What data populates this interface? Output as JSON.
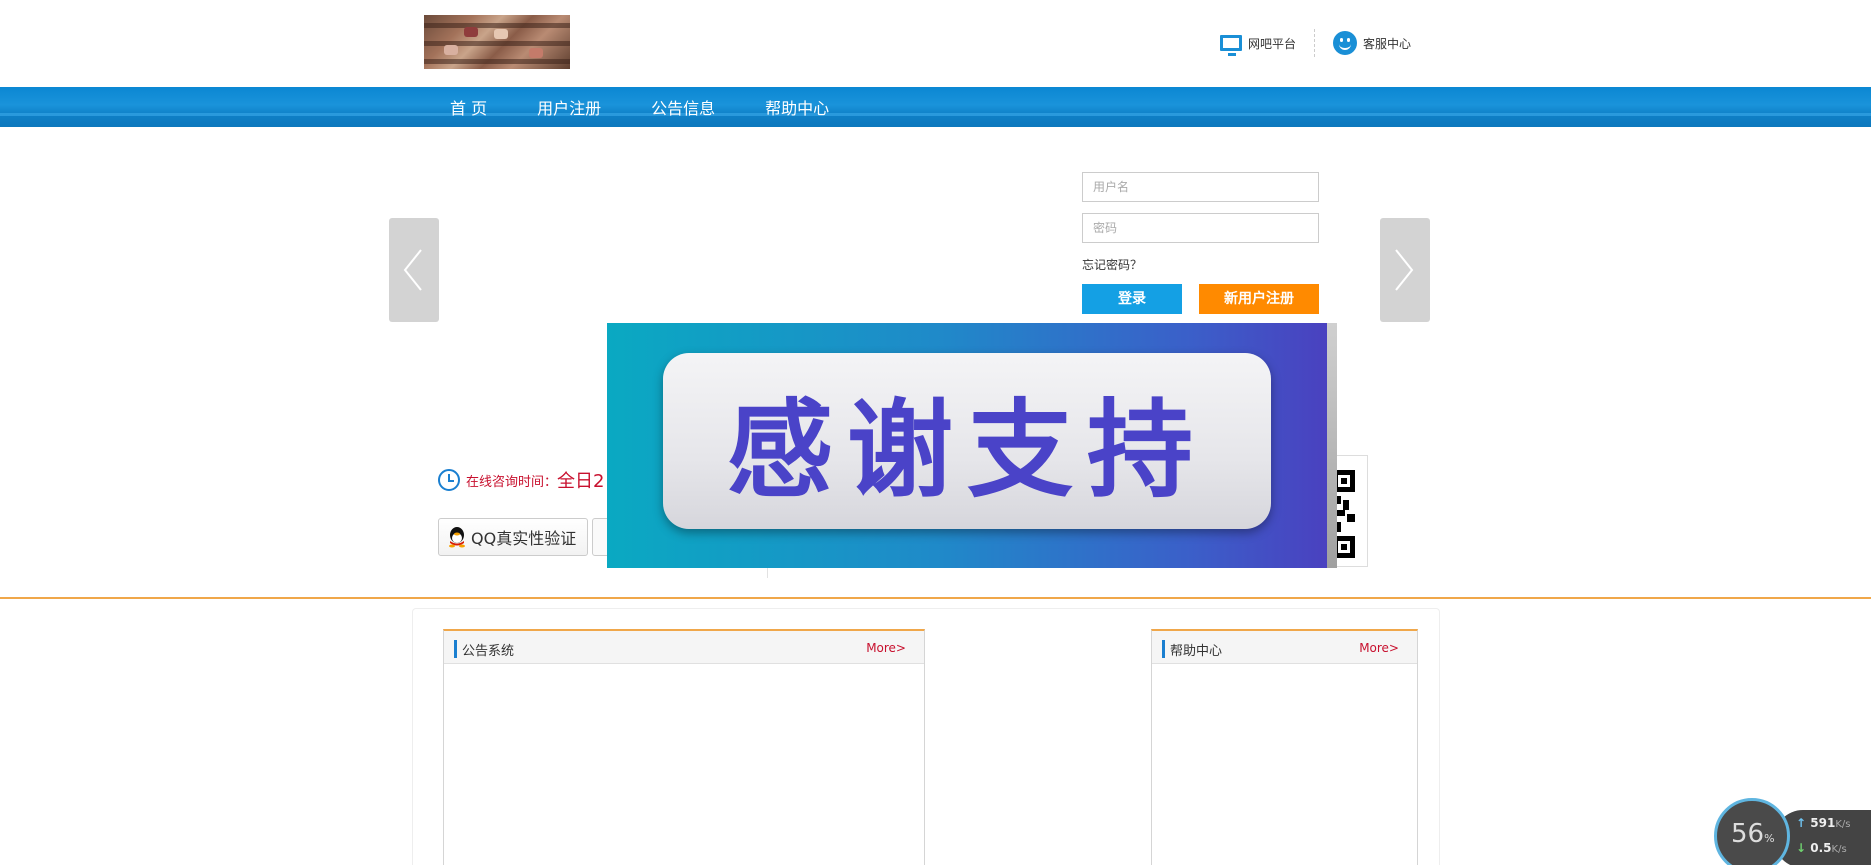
{
  "header": {
    "logo_alt": "logo",
    "links": [
      {
        "label": "网吧平台",
        "icon": "monitor-icon"
      },
      {
        "label": "客服中心",
        "icon": "smiley-icon"
      }
    ]
  },
  "nav": {
    "items": [
      "首 页",
      "用户注册",
      "公告信息",
      "帮助中心"
    ]
  },
  "login": {
    "username_placeholder": "用户名",
    "password_placeholder": "密码",
    "forgot_label": "忘记密码？",
    "login_label": "登录",
    "register_label": "新用户注册"
  },
  "consult": {
    "label": "在线咨询时间：",
    "value": "全日2"
  },
  "qq_button_label": "QQ真实性验证",
  "overlay": {
    "text": "感谢支持"
  },
  "panels": {
    "notice": {
      "title": "公告系统",
      "more": "More>"
    },
    "help": {
      "title": "帮助中心",
      "more": "More>"
    }
  },
  "speed_widget": {
    "percent": "56",
    "percent_unit": "%",
    "upload": "591",
    "upload_unit": "K/s",
    "download": "0.5",
    "download_unit": "K/s"
  },
  "colors": {
    "nav_blue": "#0b87d3",
    "accent_orange": "#ff8a00",
    "login_blue": "#14a0e4",
    "divider_orange": "#f0a74a",
    "consult_red": "#c8102e",
    "overlay_text": "#4a43c8"
  }
}
